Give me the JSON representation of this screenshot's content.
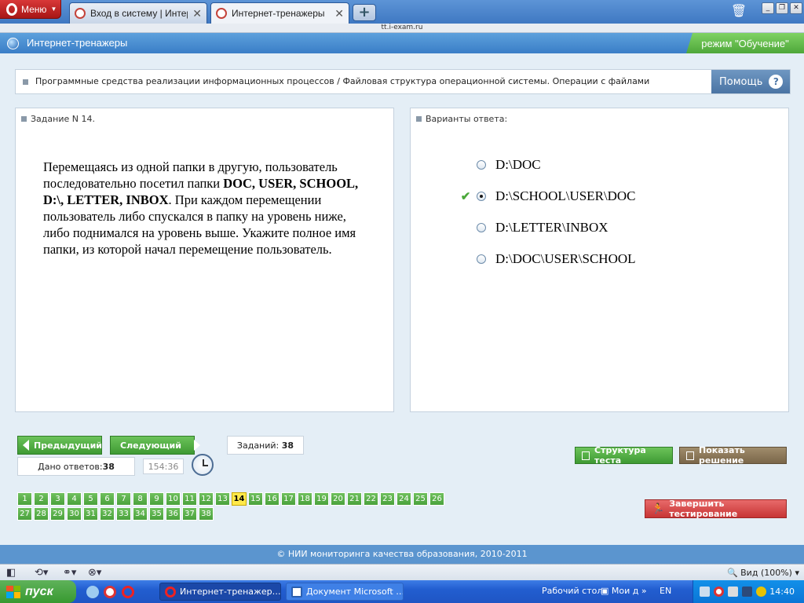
{
  "browser": {
    "menu_label": "Меню",
    "tabs": [
      {
        "title": "Вход в систему | Интер…",
        "active": false
      },
      {
        "title": "Интернет-тренажеры",
        "active": true
      }
    ],
    "new_tab_label": "+",
    "address": "tt.i-exam.ru"
  },
  "site": {
    "title": "Интернет-тренажеры",
    "mode": "режим \"Обучение\""
  },
  "breadcrumb": {
    "text": "Программные средства реализации информационных процессов / Файловая структура операционной системы. Операции с файлами",
    "help_label": "Помощь",
    "help_icon": "?"
  },
  "task": {
    "header": "Задание N 14.",
    "text_before": "Перемещаясь из одной папки в другую, пользователь последовательно посетил папки ",
    "bold_folders": "DOC, USER, SCHOOL, D:\\, LETTER, INBOX",
    "text_after": ". При каждом перемещении пользователь либо спускался в папку на уровень ниже, либо поднимался на уровень выше. Укажите полное имя папки, из которой начал перемещение пользователь."
  },
  "answers": {
    "header": "Варианты ответа:",
    "options": [
      {
        "label": "D:\\DOC",
        "selected": false,
        "correct": false
      },
      {
        "label": "D:\\SCHOOL\\USER\\DOC",
        "selected": true,
        "correct": true
      },
      {
        "label": "D:\\LETTER\\INBOX",
        "selected": false,
        "correct": false
      },
      {
        "label": "D:\\DOC\\USER\\SCHOOL",
        "selected": false,
        "correct": false
      }
    ]
  },
  "navigation": {
    "prev_label": "Предыдущий",
    "next_label": "Следующий",
    "total_label": "Заданий:",
    "total_value": "38",
    "answered_label": "Дано ответов:",
    "answered_value": "38",
    "timer": "154:36"
  },
  "actions": {
    "structure_label": "Структура теста",
    "solution_label": "Показать решение",
    "finish_label": "Завершить тестирование"
  },
  "questions": {
    "total": 38,
    "current": 14,
    "per_row": 26
  },
  "footer": {
    "text": "© НИИ мониторинга качества образования, 2010-2011"
  },
  "statusbar": {
    "zoom_label": "Вид (100%)"
  },
  "taskbar": {
    "start_label": "пуск",
    "items": [
      {
        "label": "Интернет-тренажер…"
      },
      {
        "label": "Документ Microsoft …"
      }
    ],
    "desktop_label": "Рабочий стол",
    "mydocs_label": "Мои д",
    "language": "EN",
    "time": "14:40"
  },
  "colors": {
    "header_blue": "#3a7ec7",
    "mode_green": "#4ea73a",
    "button_green": "#3e9a33",
    "finish_red": "#c73535",
    "current_question": "#ffe94a",
    "check_green": "#4aa83a"
  }
}
